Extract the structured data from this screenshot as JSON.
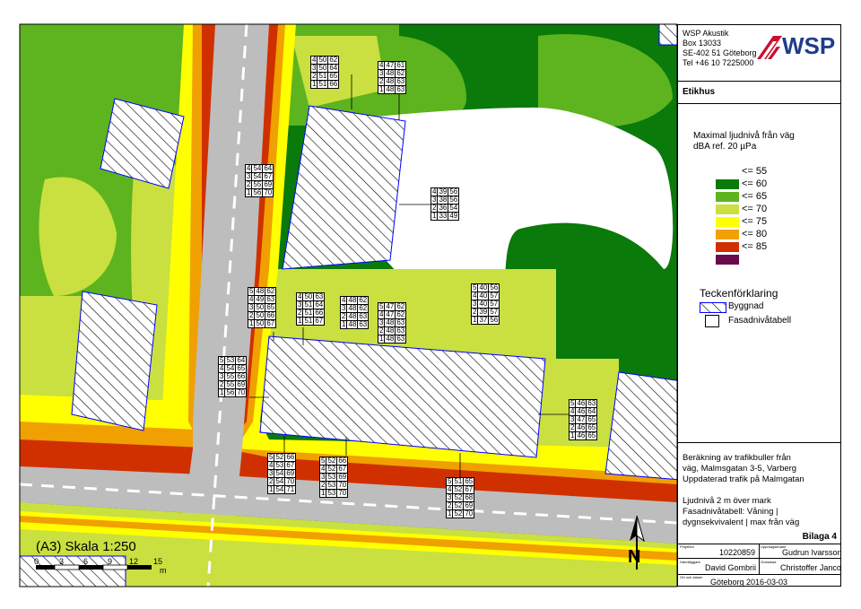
{
  "company": {
    "name": "WSP Akustik",
    "box": "Box 13033",
    "address": "SE-402 51 Göteborg",
    "phone": "Tel +46 10 7225000",
    "logo_text": "WSP"
  },
  "label_heading": "Etikhus",
  "legend": {
    "title_line1": "Maximal ljudnivå från väg",
    "title_line2": "dBA ref. 20 µPa",
    "classes": [
      {
        "low": "",
        "high": "<= 55",
        "color": "#ffffff"
      },
      {
        "low": "55 <",
        "high": "<= 60",
        "color": "#0a7a0a"
      },
      {
        "low": "60 <",
        "high": "<= 65",
        "color": "#5db41e"
      },
      {
        "low": "65 <",
        "high": "<= 70",
        "color": "#c9e040"
      },
      {
        "low": "70 <",
        "high": "<= 75",
        "color": "#ffff00"
      },
      {
        "low": "75 <",
        "high": "<= 80",
        "color": "#f0a000"
      },
      {
        "low": "80 <",
        "high": "<= 85",
        "color": "#d03000"
      },
      {
        "low": "85 <",
        "high": "",
        "color": "#6a0a4a"
      }
    ]
  },
  "key": {
    "title": "Teckenförklaring",
    "building": "Byggnad",
    "facade_table": "Fasadnivåtabell"
  },
  "description": {
    "line1": "Beräkning av trafikbuller från",
    "line2": "väg, Malmsgatan 3-5, Varberg",
    "line3": "Uppdaterad trafik på Malmgatan",
    "line4": "Ljudnivå 2 m över mark",
    "line5": "Fasadnivåtabell: Våning |",
    "line6": "dygnsekvivalent | max från väg"
  },
  "appendix": "Bilaga 4",
  "title_block": {
    "project_label": "Projektnr",
    "project_no": "10220859",
    "author_label": "Uppdragsledare",
    "author": "Gudrun Ivarsson",
    "handler_label": "Handläggare",
    "handler": "David Gombrii",
    "reviewer_label": "Granskad",
    "reviewer": "Christoffer Janco",
    "place_label": "Ort och datum",
    "place_date": "Göteborg 2016-03-03"
  },
  "scale": {
    "label": "(A3) Skala 1:250",
    "ticks": [
      "0",
      "3",
      "6",
      "9",
      "12",
      "15"
    ],
    "unit": "m"
  },
  "north": "N",
  "facade_tables": [
    {
      "rows": [
        [
          "4",
          "50",
          "62"
        ],
        [
          "3",
          "50",
          "64"
        ],
        [
          "2",
          "51",
          "65"
        ],
        [
          "1",
          "51",
          "66"
        ]
      ]
    },
    {
      "rows": [
        [
          "4",
          "47",
          "61"
        ],
        [
          "3",
          "48",
          "62"
        ],
        [
          "2",
          "48",
          "63"
        ],
        [
          "1",
          "48",
          "63"
        ]
      ]
    },
    {
      "rows": [
        [
          "4",
          "54",
          "64"
        ],
        [
          "3",
          "54",
          "67"
        ],
        [
          "2",
          "55",
          "69"
        ],
        [
          "1",
          "56",
          "70"
        ]
      ]
    },
    {
      "rows": [
        [
          "4",
          "39",
          "56"
        ],
        [
          "3",
          "38",
          "56"
        ],
        [
          "2",
          "36",
          "54"
        ],
        [
          "1",
          "33",
          "49"
        ]
      ]
    },
    {
      "rows": [
        [
          "5",
          "48",
          "62"
        ],
        [
          "4",
          "49",
          "63"
        ],
        [
          "3",
          "50",
          "65"
        ],
        [
          "2",
          "50",
          "66"
        ],
        [
          "1",
          "50",
          "67"
        ]
      ]
    },
    {
      "rows": [
        [
          "4",
          "50",
          "63"
        ],
        [
          "3",
          "51",
          "64"
        ],
        [
          "2",
          "51",
          "66"
        ],
        [
          "1",
          "51",
          "67"
        ]
      ]
    },
    {
      "rows": [
        [
          "4",
          "48",
          "62"
        ],
        [
          "3",
          "48",
          "62"
        ],
        [
          "2",
          "48",
          "63"
        ],
        [
          "1",
          "48",
          "63"
        ]
      ]
    },
    {
      "rows": [
        [
          "5",
          "47",
          "62"
        ],
        [
          "4",
          "47",
          "62"
        ],
        [
          "3",
          "48",
          "63"
        ],
        [
          "2",
          "48",
          "63"
        ],
        [
          "1",
          "48",
          "63"
        ]
      ]
    },
    {
      "rows": [
        [
          "5",
          "40",
          "56"
        ],
        [
          "4",
          "40",
          "57"
        ],
        [
          "3",
          "40",
          "57"
        ],
        [
          "2",
          "39",
          "57"
        ],
        [
          "1",
          "37",
          "56"
        ]
      ]
    },
    {
      "rows": [
        [
          "5",
          "53",
          "64"
        ],
        [
          "4",
          "54",
          "65"
        ],
        [
          "3",
          "55",
          "66"
        ],
        [
          "2",
          "55",
          "69"
        ],
        [
          "1",
          "56",
          "70"
        ]
      ]
    },
    {
      "rows": [
        [
          "5",
          "46",
          "63"
        ],
        [
          "4",
          "46",
          "64"
        ],
        [
          "3",
          "47",
          "65"
        ],
        [
          "2",
          "46",
          "65"
        ],
        [
          "1",
          "46",
          "65"
        ]
      ]
    },
    {
      "rows": [
        [
          "5",
          "52",
          "66"
        ],
        [
          "4",
          "53",
          "67"
        ],
        [
          "3",
          "54",
          "69"
        ],
        [
          "2",
          "54",
          "70"
        ],
        [
          "1",
          "54",
          "71"
        ]
      ]
    },
    {
      "rows": [
        [
          "5",
          "52",
          "66"
        ],
        [
          "4",
          "52",
          "67"
        ],
        [
          "3",
          "53",
          "69"
        ],
        [
          "2",
          "53",
          "70"
        ],
        [
          "1",
          "53",
          "70"
        ]
      ]
    },
    {
      "rows": [
        [
          "5",
          "51",
          "65"
        ],
        [
          "4",
          "52",
          "67"
        ],
        [
          "3",
          "52",
          "68"
        ],
        [
          "2",
          "52",
          "69"
        ],
        [
          "1",
          "52",
          "70"
        ]
      ]
    }
  ]
}
